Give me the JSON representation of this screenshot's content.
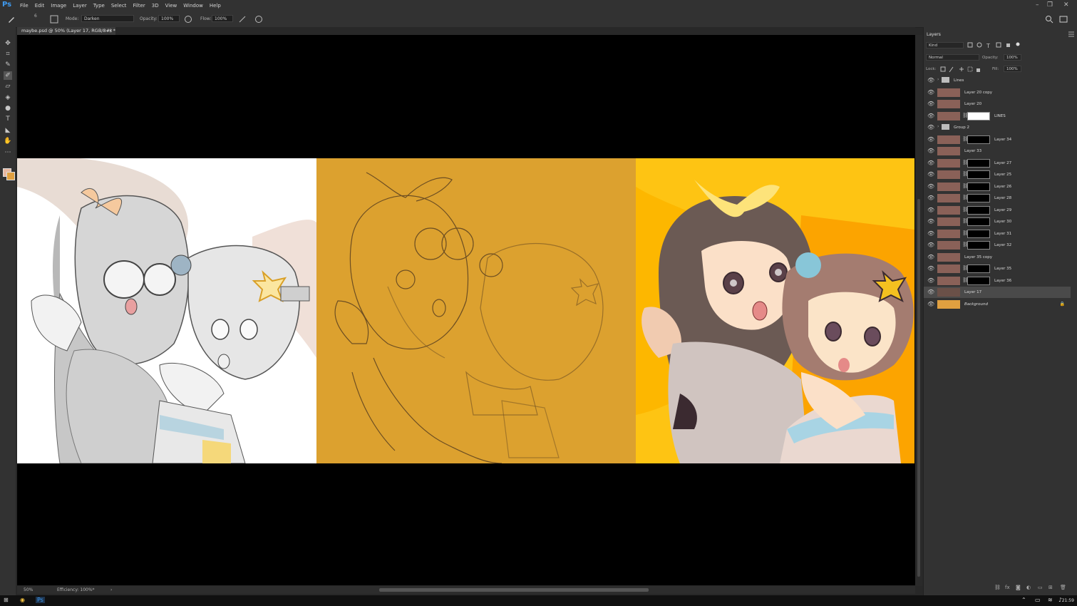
{
  "app": {
    "logo": "Ps"
  },
  "menu": [
    "File",
    "Edit",
    "Image",
    "Layer",
    "Type",
    "Select",
    "Filter",
    "3D",
    "View",
    "Window",
    "Help"
  ],
  "window_controls": {
    "minimize": "–",
    "restore": "❐",
    "close": "✕"
  },
  "options": {
    "size": "6",
    "mode_label": "Mode:",
    "mode_value": "Darken",
    "opacity_label": "Opacity:",
    "opacity_value": "100%",
    "flow_label": "Flow:",
    "flow_value": "100%"
  },
  "document": {
    "tab_title": "maybe.psd @ 50% (Layer 17, RGB/8#) *",
    "tab_close": "×"
  },
  "status": {
    "zoom": "50%",
    "info": "Efficiency: 100%*",
    "arrow": "›"
  },
  "layers_panel": {
    "title": "Layers",
    "filter_kind": "Kind",
    "blend_mode": "Normal",
    "opacity_label": "Opacity:",
    "opacity_value": "100%",
    "lock_label": "Lock:",
    "fill_label": "Fill:",
    "fill_value": "100%",
    "layers": [
      {
        "name": "Lines",
        "type": "group"
      },
      {
        "name": "Layer 20 copy",
        "type": "layer"
      },
      {
        "name": "Layer 20",
        "type": "layer"
      },
      {
        "name": "LINES",
        "type": "masked",
        "mask": "white"
      },
      {
        "name": "Group 2",
        "type": "group"
      },
      {
        "name": "Layer 34",
        "type": "masked",
        "mask": "black"
      },
      {
        "name": "Layer 33",
        "type": "layer"
      },
      {
        "name": "Layer 27",
        "type": "masked",
        "mask": "black"
      },
      {
        "name": "Layer 25",
        "type": "masked",
        "mask": "black"
      },
      {
        "name": "Layer 26",
        "type": "masked",
        "mask": "black"
      },
      {
        "name": "Layer 28",
        "type": "masked",
        "mask": "black"
      },
      {
        "name": "Layer 29",
        "type": "masked",
        "mask": "black"
      },
      {
        "name": "Layer 30",
        "type": "masked",
        "mask": "black"
      },
      {
        "name": "Layer 31",
        "type": "masked",
        "mask": "black"
      },
      {
        "name": "Layer 32",
        "type": "masked",
        "mask": "black"
      },
      {
        "name": "Layer 35 copy",
        "type": "layer"
      },
      {
        "name": "Layer 35",
        "type": "masked",
        "mask": "black"
      },
      {
        "name": "Layer 36",
        "type": "masked",
        "mask": "black"
      },
      {
        "name": "Layer 17",
        "type": "layer",
        "selected": true
      },
      {
        "name": "Background",
        "type": "background"
      }
    ],
    "footer_icons": [
      "link-icon",
      "fx-icon",
      "mask-icon",
      "adjustment-icon",
      "folder-icon",
      "new-layer-icon",
      "trash-icon"
    ]
  },
  "taskbar": {
    "time": "21:59"
  },
  "colors": {
    "panel_bg": "#323232",
    "canvas_bg": "#000000",
    "art_orange": "#dca12f",
    "art_yellow": "#fec413",
    "foreground_swatch": "#e8b8a0",
    "background_swatch": "#e0a040"
  }
}
